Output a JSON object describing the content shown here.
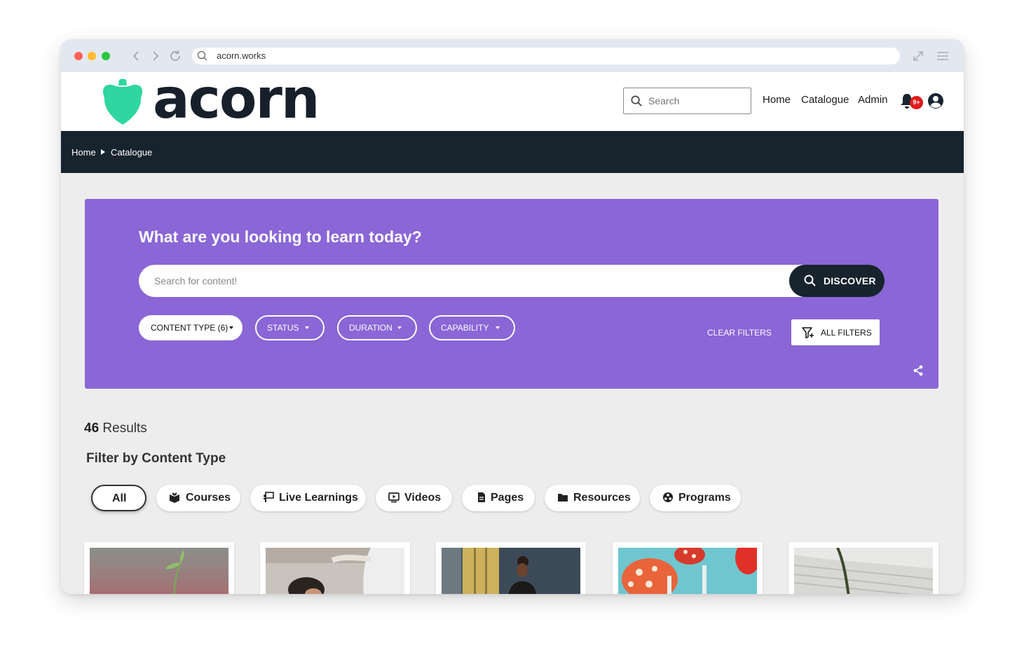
{
  "browser": {
    "url": "acorn.works",
    "icons": [
      "chevron-left-icon",
      "chevron-right-icon",
      "reload-icon",
      "search-icon",
      "expand-icon",
      "menu-icon"
    ]
  },
  "header": {
    "logo_text": "acorn",
    "search_placeholder": "Search",
    "nav": [
      "Home",
      "Catalogue",
      "Admin"
    ],
    "notification_badge": "9+",
    "colors": {
      "brand": "#2fd6a0",
      "dark": "#17232d"
    }
  },
  "breadcrumb": {
    "items": [
      "Home",
      "Catalogue"
    ]
  },
  "hero": {
    "title": "What are you looking to learn today?",
    "search_placeholder": "Search for content!",
    "discover_label": "DISCOVER",
    "filters": [
      "CONTENT TYPE (6)",
      "STATUS",
      "DURATION",
      "CAPABILITY"
    ],
    "clear_filters_label": "CLEAR FILTERS",
    "all_filters_label": "ALL FILTERS",
    "background_color": "#8a66d6"
  },
  "results": {
    "count": "46",
    "label": "Results",
    "filter_heading": "Filter by Content Type",
    "content_types": [
      {
        "label": "All",
        "icon": "",
        "active": true
      },
      {
        "label": "Courses",
        "icon": "book-icon"
      },
      {
        "label": "Live Learnings",
        "icon": "presenter-icon"
      },
      {
        "label": "Videos",
        "icon": "video-icon"
      },
      {
        "label": "Pages",
        "icon": "document-icon"
      },
      {
        "label": "Resources",
        "icon": "folder-icon"
      },
      {
        "label": "Programs",
        "icon": "programs-icon"
      }
    ]
  }
}
